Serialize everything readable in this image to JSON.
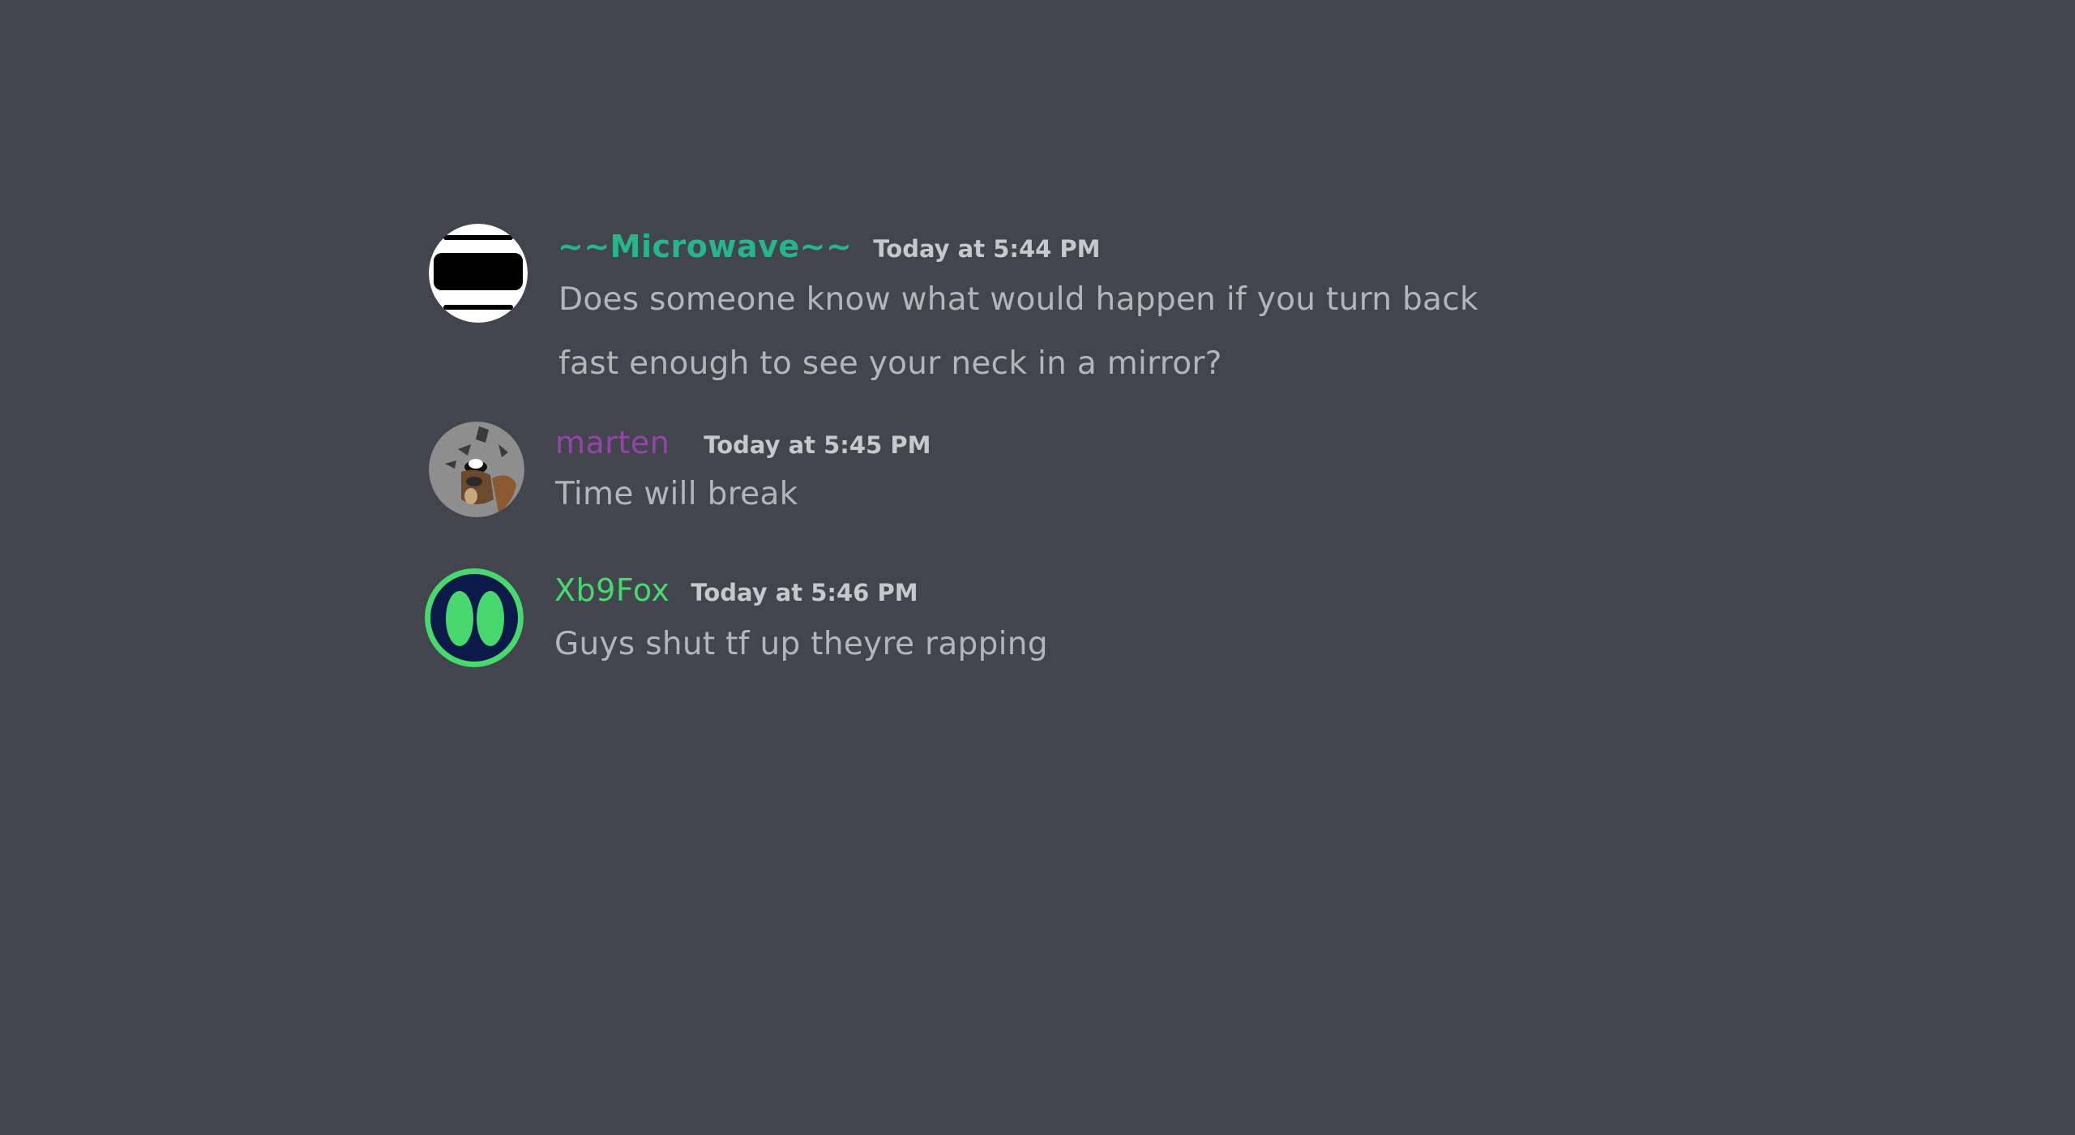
{
  "messages": [
    {
      "username": "~~Microwave~~",
      "username_color": "#27b68c",
      "timestamp": "Today at 5:44 PM",
      "lines": [
        "Does someone know what would happen if you turn back",
        "fast enough to see your neck in a mirror?"
      ],
      "avatar_icon": "microwave-avatar-icon"
    },
    {
      "username": "marten",
      "username_color": "#9247a8",
      "timestamp": "Today at 5:45 PM",
      "lines": [
        "Time will break"
      ],
      "avatar_icon": "marten-avatar-icon"
    },
    {
      "username": "Xb9Fox",
      "username_color": "#47d86e",
      "timestamp": "Today at 5:46 PM",
      "lines": [
        "Guys shut tf up theyre rapping"
      ],
      "avatar_icon": "xb9fox-avatar-icon"
    }
  ]
}
